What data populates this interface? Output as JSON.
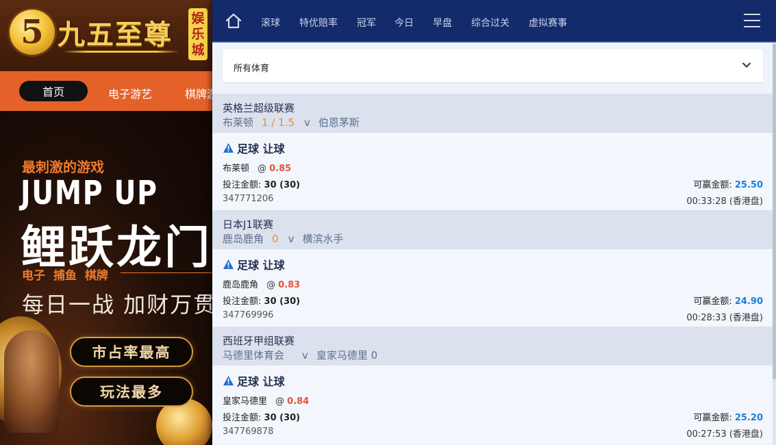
{
  "site": {
    "logo_numeral": "5",
    "logo_text": "九五至尊",
    "logo_side": [
      "娱",
      "乐",
      "城"
    ],
    "nav": {
      "home": "首页",
      "items": [
        "电子游艺",
        "棋牌游"
      ]
    },
    "banner": {
      "tag": "最刺激的游戏",
      "title_en": "JUMP UP",
      "title_cn": "鲤跃龙门",
      "categories": "电子 捕鱼 棋牌",
      "slogan": "每日一战 加财万贯",
      "pill_1": "市占率最高",
      "pill_2": "玩法最多"
    }
  },
  "sportsbook": {
    "tabs": [
      "滚球",
      "特优赔率",
      "冠军",
      "今日",
      "早盘",
      "综合过关",
      "虚拟赛事"
    ],
    "sport_filter": "所有体育",
    "bets": [
      {
        "league": "英格兰超级联赛",
        "home": "布莱顿",
        "handicap": "1 / 1.5",
        "vs": "v",
        "away": "伯恩茅斯",
        "title": "足球 让球",
        "pick": "布莱顿",
        "at": "@",
        "odds": "0.85",
        "stake_label": "投注金额:",
        "stake": "30 (30)",
        "win_label": "可赢金额:",
        "win": "25.50",
        "id": "347771206",
        "time": "00:33:28 (香港盘)"
      },
      {
        "league": "日本J1联赛",
        "home": "鹿岛鹿角",
        "handicap": "0",
        "vs": "v",
        "away": "横滨水手",
        "title": "足球 让球",
        "pick": "鹿岛鹿角",
        "at": "@",
        "odds": "0.83",
        "stake_label": "投注金额:",
        "stake": "30 (30)",
        "win_label": "可赢金额:",
        "win": "24.90",
        "id": "347769996",
        "time": "00:28:33 (香港盘)"
      },
      {
        "league": "西班牙甲组联赛",
        "home": "马德里体育会",
        "handicap": "",
        "vs": "v",
        "away": "皇家马德里 0",
        "title": "足球 让球",
        "pick": "皇家马德里",
        "at": "@",
        "odds": "0.84",
        "stake_label": "投注金额:",
        "stake": "30 (30)",
        "win_label": "可赢金额:",
        "win": "25.20",
        "id": "347769878",
        "time": "00:27:53 (香港盘)"
      }
    ]
  },
  "colors": {
    "topbar": "#132a6b",
    "handicap": "#f08a2a",
    "odds": "#e0563a",
    "win": "#1c7ed6",
    "site_nav": "#e4622a"
  }
}
